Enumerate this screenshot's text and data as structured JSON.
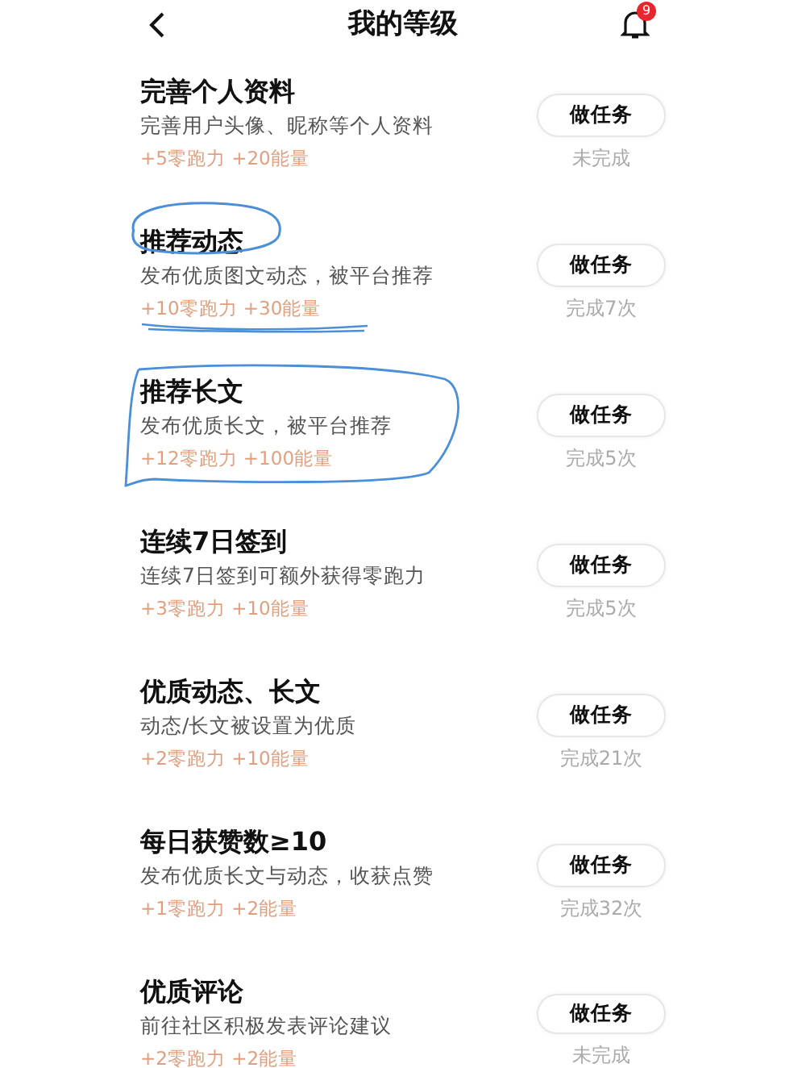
{
  "header": {
    "title": "我的等级",
    "notification_badge": "9"
  },
  "tasks": [
    {
      "title": "完善个人资料",
      "description": "完善用户头像、昵称等个人资料",
      "reward": "+5零跑力 +20能量",
      "button": "做任务",
      "status": "未完成"
    },
    {
      "title": "推荐动态",
      "description": "发布优质图文动态，被平台推荐",
      "reward": "+10零跑力 +30能量",
      "button": "做任务",
      "status": "完成7次",
      "title_circled": true,
      "reward_underlined": true
    },
    {
      "title": "推荐长文",
      "description": "发布优质长文，被平台推荐",
      "reward": "+12零跑力 +100能量",
      "button": "做任务",
      "status": "完成5次",
      "block_circled": true
    },
    {
      "title": "连续7日签到",
      "description": "连续7日签到可额外获得零跑力",
      "reward": "+3零跑力 +10能量",
      "button": "做任务",
      "status": "完成5次"
    },
    {
      "title": "优质动态、长文",
      "description": "动态/长文被设置为优质",
      "reward": "+2零跑力 +10能量",
      "button": "做任务",
      "status": "完成21次"
    },
    {
      "title": "每日获赞数≥10",
      "description": "发布优质长文与动态，收获点赞",
      "reward": "+1零跑力 +2能量",
      "button": "做任务",
      "status": "完成32次"
    },
    {
      "title": "优质评论",
      "description": "前往社区积极发表评论建议",
      "reward": "+2零跑力 +2能量",
      "button": "做任务",
      "status": "未完成"
    }
  ]
}
